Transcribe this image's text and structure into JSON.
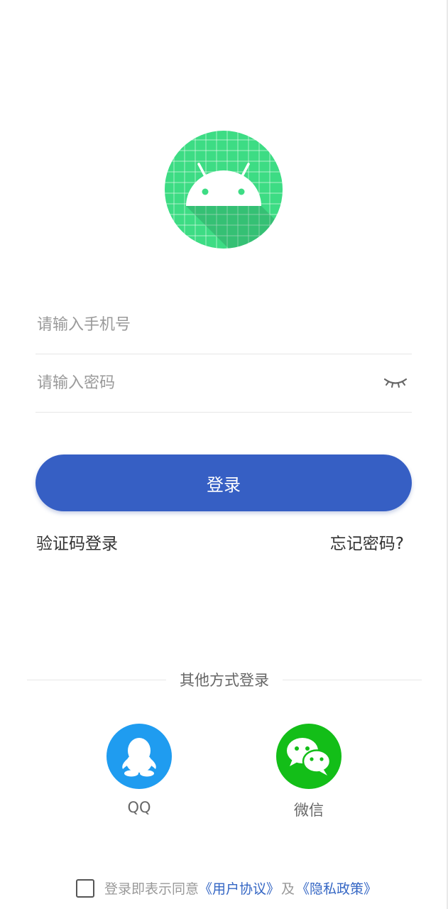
{
  "login_form": {
    "phone_placeholder": "请输入手机号",
    "password_placeholder": "请输入密码",
    "login_button_label": "登录",
    "sms_login_label": "验证码登录",
    "forgot_password_label": "忘记密码?"
  },
  "other_login": {
    "divider_label": "其他方式登录",
    "options": [
      {
        "label": "QQ",
        "icon": "qq-penguin-icon",
        "color": "#1f9cf0"
      },
      {
        "label": "微信",
        "icon": "wechat-icon",
        "color": "#13be18"
      }
    ]
  },
  "agreement": {
    "prefix": "登录即表示同意",
    "user_agreement": "《用户协议》",
    "conjunction": "及",
    "privacy_policy": "《隐私政策》",
    "checked": false
  },
  "colors": {
    "primary": "#365fc4",
    "logo_green": "#3ddc84",
    "link_blue": "#3466c4"
  }
}
